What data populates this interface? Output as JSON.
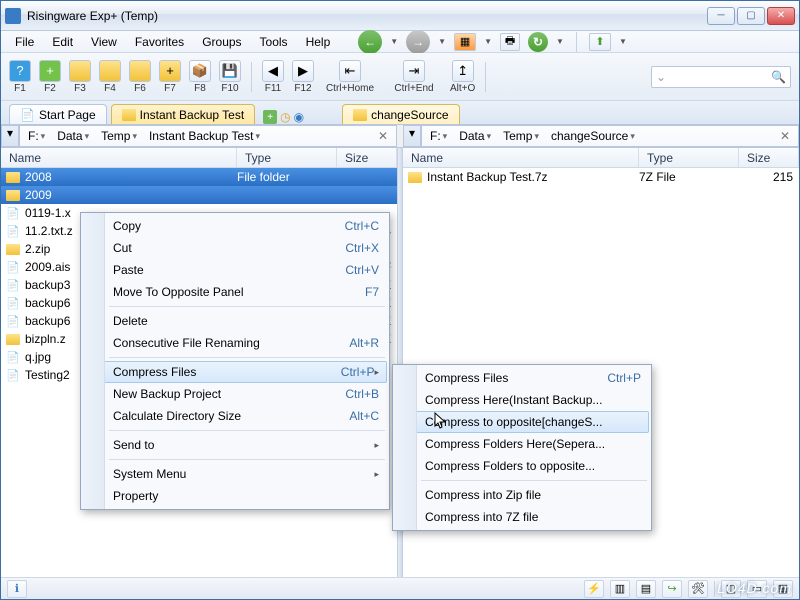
{
  "titlebar": {
    "title": "Risingware Exp+  (Temp)"
  },
  "menubar": [
    "File",
    "Edit",
    "View",
    "Favorites",
    "Groups",
    "Tools",
    "Help"
  ],
  "toolbar_main": [
    {
      "label": "F1",
      "icon": "help"
    },
    {
      "label": "F2",
      "icon": "plus"
    },
    {
      "label": "F3",
      "icon": "folder"
    },
    {
      "label": "F4",
      "icon": "folder"
    },
    {
      "label": "F6",
      "icon": "folder"
    },
    {
      "label": "F7",
      "icon": "plusfolder"
    },
    {
      "label": "F8",
      "icon": "box"
    },
    {
      "label": "F10",
      "icon": "disk"
    }
  ],
  "toolbar_ext": [
    {
      "label": "F11",
      "icon": "left"
    },
    {
      "label": "F12",
      "icon": "right"
    },
    {
      "label": "Ctrl+Home",
      "icon": "home"
    },
    {
      "label": "Ctrl+End",
      "icon": "end"
    },
    {
      "label": "Alt+O",
      "icon": "up"
    }
  ],
  "tabs": {
    "left": [
      {
        "label": "Start Page",
        "active": false,
        "icon": "page"
      },
      {
        "label": "Instant Backup Test",
        "active": true,
        "icon": "folder"
      }
    ],
    "right": [
      {
        "label": "changeSource",
        "active": true,
        "icon": "folder"
      }
    ]
  },
  "breadcrumb": {
    "left": [
      "F:",
      "Data",
      "Temp",
      "Instant Backup Test"
    ],
    "right": [
      "F:",
      "Data",
      "Temp",
      "changeSource"
    ]
  },
  "columns": {
    "name": "Name",
    "type": "Type",
    "size": "Size"
  },
  "left_files": [
    {
      "name": "2008",
      "type": "File folder",
      "size": "",
      "kind": "folder",
      "sel": true
    },
    {
      "name": "2009",
      "type": "",
      "size": "",
      "kind": "folder",
      "sel": true
    },
    {
      "name": "0119-1.x",
      "type": "",
      "size": "",
      "kind": "file"
    },
    {
      "name": "11.2.txt.z",
      "type": "",
      "size": "KB",
      "kind": "file"
    },
    {
      "name": "2.zip",
      "type": "",
      "size": "",
      "kind": "folder"
    },
    {
      "name": "2009.ais",
      "type": "",
      "size": "06 F",
      "kind": "file"
    },
    {
      "name": "backup3",
      "type": "",
      "size": "KE",
      "kind": "file"
    },
    {
      "name": "backup6",
      "type": "",
      "size": "KE",
      "kind": "file"
    },
    {
      "name": "backup6",
      "type": "",
      "size": "KE",
      "kind": "file"
    },
    {
      "name": "bizpln.z",
      "type": "",
      "size": "KE",
      "kind": "folder"
    },
    {
      "name": "q.jpg",
      "type": "",
      "size": "",
      "kind": "file"
    },
    {
      "name": "Testing2",
      "type": "",
      "size": "",
      "kind": "file"
    }
  ],
  "right_files": [
    {
      "name": "Instant Backup Test.7z",
      "type": "7Z File",
      "size": "215",
      "kind": "folder"
    }
  ],
  "context_menu": {
    "items": [
      {
        "label": "Copy",
        "shortcut": "Ctrl+C",
        "icon": "copy"
      },
      {
        "label": "Cut",
        "shortcut": "Ctrl+X",
        "icon": "cut"
      },
      {
        "label": "Paste",
        "shortcut": "Ctrl+V",
        "icon": "paste"
      },
      {
        "label": "Move To Opposite Panel",
        "shortcut": "F7",
        "icon": "move"
      },
      {
        "sep": true
      },
      {
        "label": "Delete",
        "shortcut": "",
        "icon": "delete"
      },
      {
        "label": "Consecutive File Renaming",
        "shortcut": "Alt+R",
        "icon": "rename"
      },
      {
        "sep": true
      },
      {
        "label": "Compress Files",
        "shortcut": "Ctrl+P",
        "icon": "compress",
        "sub": true,
        "hl": true
      },
      {
        "label": "New Backup Project",
        "shortcut": "Ctrl+B",
        "icon": "backup"
      },
      {
        "label": "Calculate Directory Size",
        "shortcut": "Alt+C",
        "icon": "calc"
      },
      {
        "sep": true
      },
      {
        "label": "Send to",
        "shortcut": "",
        "sub": true
      },
      {
        "sep": true
      },
      {
        "label": "System Menu",
        "shortcut": "",
        "sub": true
      },
      {
        "label": "Property",
        "shortcut": ""
      }
    ]
  },
  "sub_menu": {
    "items": [
      {
        "label": "Compress Files",
        "shortcut": "Ctrl+P",
        "icon": "compress"
      },
      {
        "label": "Compress Here(Instant Backup..."
      },
      {
        "label": "Compress to opposite[changeS...",
        "icon": "compress",
        "hl": true
      },
      {
        "label": "Compress Folders Here(Sepera..."
      },
      {
        "label": "Compress Folders to opposite..."
      },
      {
        "sep": true
      },
      {
        "label": "Compress into Zip file",
        "check": true
      },
      {
        "label": "Compress into 7Z file"
      }
    ]
  },
  "watermark": "LO4D.com"
}
